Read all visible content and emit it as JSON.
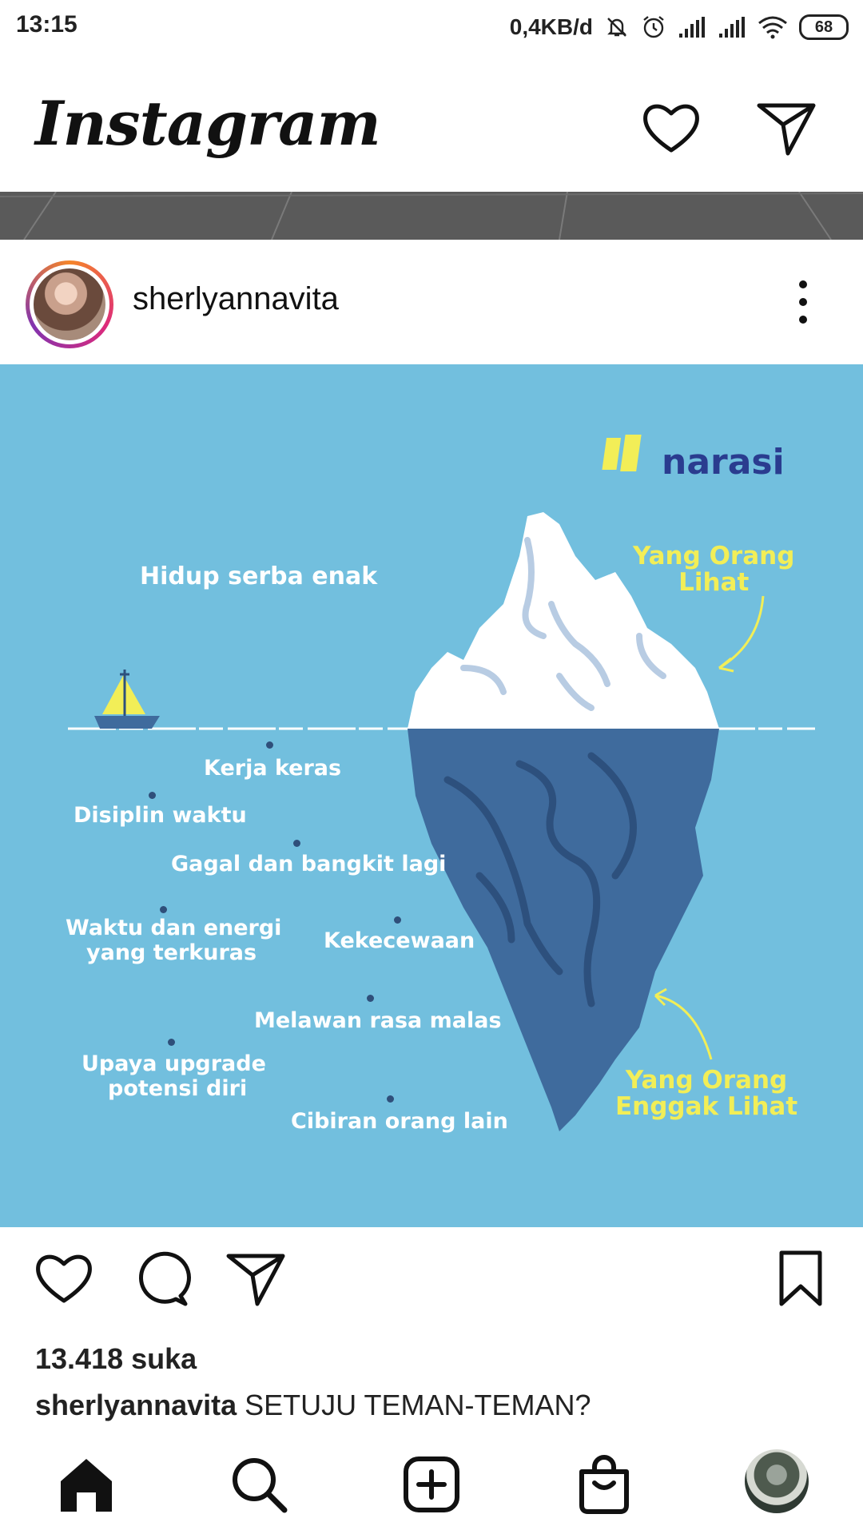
{
  "status_bar": {
    "time": "13:15",
    "network_speed": "0,4KB/d",
    "battery": "68",
    "icons": [
      "mute-icon",
      "alarm-icon",
      "signal-icon",
      "signal-icon",
      "wifi-icon",
      "battery-icon"
    ]
  },
  "header": {
    "logo": "Instagram",
    "icons": [
      "heart-icon",
      "direct-message-icon"
    ]
  },
  "post": {
    "username": "sherlyannavita",
    "image": {
      "brand": "narasi",
      "top_label": "Hidup serba enak",
      "visible_label": "Yang Orang\nLihat",
      "hidden_label": "Yang Orang\nEnggak Lihat",
      "hidden_items": [
        "Kerja keras",
        "Disiplin waktu",
        "Gagal dan bangkit lagi",
        "Waktu dan energi",
        "yang terkuras",
        "Kekecewaan",
        "Melawan rasa malas",
        "Upaya upgrade",
        "potensi diri",
        "Cibiran orang lain"
      ]
    },
    "likes": "13.418 suka",
    "caption_user": "sherlyannavita",
    "caption_text": "SETUJU TEMAN-TEMAN?"
  },
  "bottom_nav": [
    "home-icon",
    "search-icon",
    "add-post-icon",
    "shop-icon",
    "profile-avatar"
  ]
}
